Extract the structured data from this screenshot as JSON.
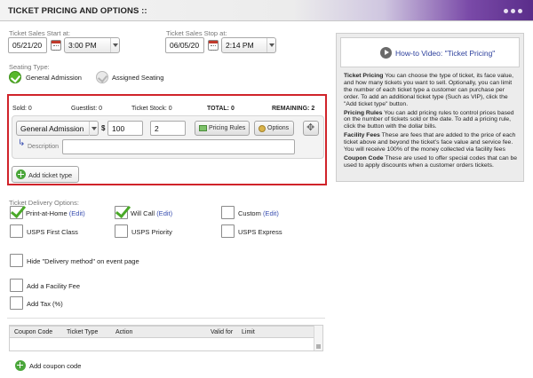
{
  "header": {
    "title": "TICKET PRICING AND OPTIONS ::"
  },
  "sales_start": {
    "label": "Ticket Sales Start at:",
    "date": "05/21/20",
    "time": "3:00 PM"
  },
  "sales_stop": {
    "label": "Ticket Sales Stop at:",
    "date": "06/05/20",
    "time": "2:14 PM"
  },
  "seating": {
    "label": "Seating Type:",
    "general": "General Admission",
    "assigned": "Assigned Seating",
    "selected": "general"
  },
  "ticket_box": {
    "stats": {
      "sold": "Sold: 0",
      "guestlist": "Guestlist: 0",
      "stock": "Ticket Stock: 0",
      "total": "TOTAL: 0",
      "remaining": "REMAINING: 2"
    },
    "ticket_type": "General Admission",
    "currency": "$",
    "price": "100",
    "quantity": "2",
    "pricing_rules_label": "Pricing Rules",
    "options_label": "Options",
    "description_label": "Description",
    "description_value": "",
    "add_ticket_type_label": "Add ticket type"
  },
  "delivery": {
    "label": "Ticket Delivery Options:",
    "options": [
      {
        "label": "Print-at-Home",
        "edit": "(Edit)",
        "checked": true
      },
      {
        "label": "Will Call",
        "edit": "(Edit)",
        "checked": true
      },
      {
        "label": "Custom",
        "edit": "(Edit)",
        "checked": false
      },
      {
        "label": "USPS First Class",
        "edit": "",
        "checked": false
      },
      {
        "label": "USPS Priority",
        "edit": "",
        "checked": false
      },
      {
        "label": "USPS Express",
        "edit": "",
        "checked": false
      }
    ]
  },
  "extras": {
    "hide_delivery": "Hide \"Delivery method\" on event page",
    "facility_fee": "Add a Facility Fee",
    "add_tax": "Add Tax (%)"
  },
  "coupons": {
    "columns": [
      "Coupon Code",
      "Ticket Type",
      "Action",
      "Valid for",
      "Limit"
    ],
    "add_label": "Add coupon code"
  },
  "help_panel": {
    "video_title": "How-to Video: \"Ticket Pricing\"",
    "sections": [
      {
        "title": "Ticket Pricing",
        "text": "You can choose the type of ticket, its face value, and how many tickets you want to sell. Optionally, you can limit the number of each ticket type a customer can purchase per order. To add an additional ticket type (Such as VIP), click the \"Add ticket type\" button."
      },
      {
        "title": "Pricing Rules",
        "text": "You can add pricing rules to control prices based on the number of tickets sold or the date. To add a pricing rule, click the button with the dollar bills."
      },
      {
        "title": "Facility Fees",
        "text": "These are fees that are added to the price of each ticket above and beyond the ticket's face value and service fee. You will receive 100% of the money collected via facility fees"
      },
      {
        "title": "Coupon Code",
        "text": "These are used to offer special codes that can be used to apply discounts when a customer orders tickets."
      }
    ]
  }
}
